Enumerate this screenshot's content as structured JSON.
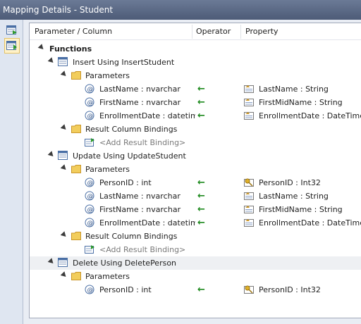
{
  "window": {
    "title": "Mapping Details - Student"
  },
  "sidebar": {
    "buttons": [
      {
        "icon": "map-entity-to-tables-icon"
      },
      {
        "icon": "map-entity-to-functions-icon"
      }
    ]
  },
  "columns": {
    "param": "Parameter / Column",
    "operator": "Operator",
    "property": "Property"
  },
  "rows": [
    {
      "label": "Functions"
    },
    {
      "label": "Insert Using InsertStudent"
    },
    {
      "label": "Parameters"
    },
    {
      "label": "LastName : nvarchar",
      "operator": "←",
      "property": "LastName : String"
    },
    {
      "label": "FirstName : nvarchar",
      "operator": "←",
      "property": "FirstMidName : String"
    },
    {
      "label": "EnrollmentDate : datetime",
      "operator": "←",
      "property": "EnrollmentDate : DateTime"
    },
    {
      "label": "Result Column Bindings"
    },
    {
      "label": "<Add Result Binding>"
    },
    {
      "label": "Update Using UpdateStudent"
    },
    {
      "label": "Parameters"
    },
    {
      "label": "PersonID : int",
      "operator": "←",
      "property": "PersonID : Int32"
    },
    {
      "label": "LastName : nvarchar",
      "operator": "←",
      "property": "LastName : String"
    },
    {
      "label": "FirstName : nvarchar",
      "operator": "←",
      "property": "FirstMidName : String"
    },
    {
      "label": "EnrollmentDate : datetime",
      "operator": "←",
      "property": "EnrollmentDate : DateTime"
    },
    {
      "label": "Result Column Bindings"
    },
    {
      "label": "<Add Result Binding>"
    },
    {
      "label": "Delete Using DeletePerson"
    },
    {
      "label": "Parameters"
    },
    {
      "label": "PersonID : int",
      "operator": "←",
      "property": "PersonID : Int32"
    }
  ]
}
